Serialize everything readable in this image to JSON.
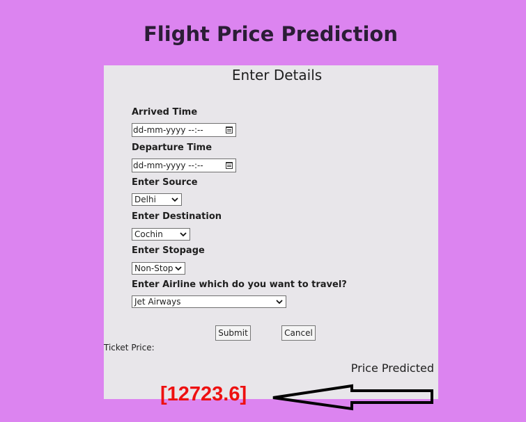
{
  "header": {
    "title": "Flight Price Prediction"
  },
  "form": {
    "title": "Enter Details",
    "arrived_label": "Arrived Time",
    "arrived_placeholder": "dd-mm-yyyy --:--",
    "departure_label": "Departure Time",
    "departure_placeholder": "dd-mm-yyyy --:--",
    "source_label": "Enter Source",
    "source_value": "Delhi",
    "destination_label": "Enter Destination",
    "destination_value": "Cochin",
    "stopage_label": "Enter Stopage",
    "stopage_value": "Non-Stop",
    "airline_label": "Enter Airline which do you want to travel?",
    "airline_value": "Jet Airways",
    "submit_label": "Submit",
    "cancel_label": "Cancel"
  },
  "result": {
    "ticket_label": "Ticket Price:",
    "predicted_label": "Price Predicted",
    "value": "[12723.6]"
  },
  "colors": {
    "page_bg": "#dc84f0",
    "card_bg": "#e8e6ea",
    "price": "#ee1010"
  }
}
